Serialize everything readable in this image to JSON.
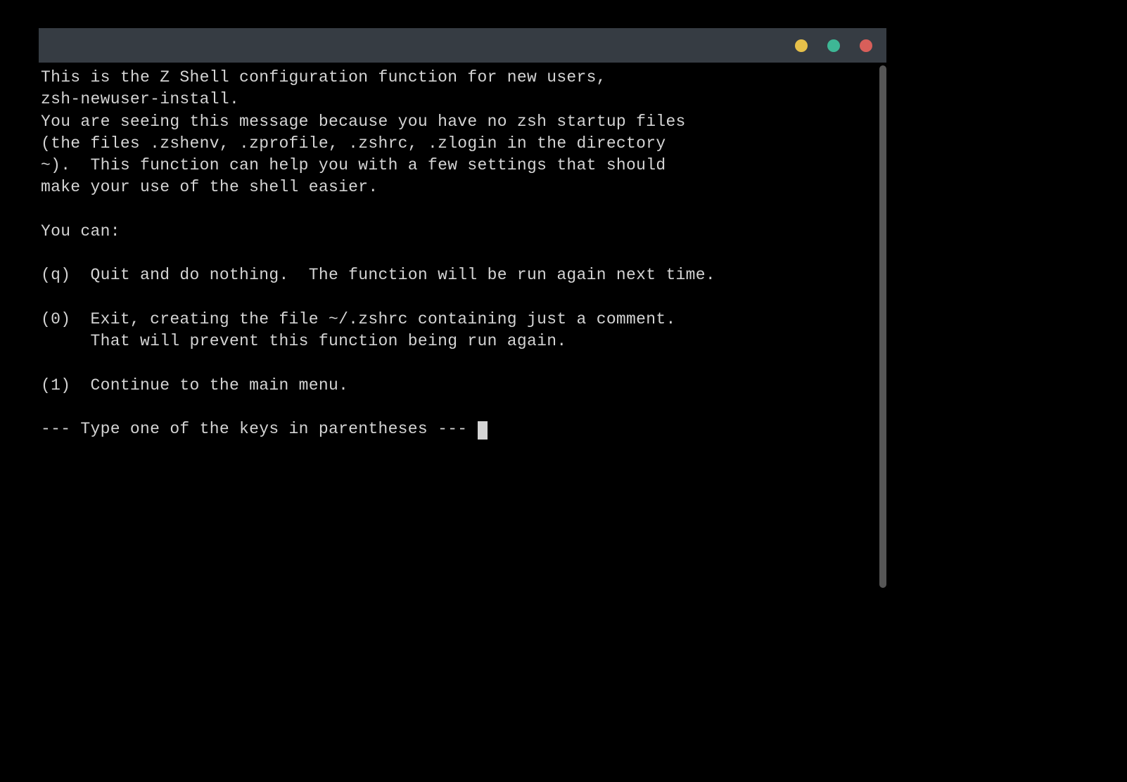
{
  "window": {
    "controls": {
      "minimize_color": "#e6c04a",
      "maximize_color": "#3eb795",
      "close_color": "#d85f5a"
    }
  },
  "terminal": {
    "lines": [
      "This is the Z Shell configuration function for new users,",
      "zsh-newuser-install.",
      "You are seeing this message because you have no zsh startup files",
      "(the files .zshenv, .zprofile, .zshrc, .zlogin in the directory",
      "~).  This function can help you with a few settings that should",
      "make your use of the shell easier.",
      "",
      "You can:",
      "",
      "(q)  Quit and do nothing.  The function will be run again next time.",
      "",
      "(0)  Exit, creating the file ~/.zshrc containing just a comment.",
      "     That will prevent this function being run again.",
      "",
      "(1)  Continue to the main menu.",
      ""
    ],
    "prompt": "--- Type one of the keys in parentheses --- "
  }
}
